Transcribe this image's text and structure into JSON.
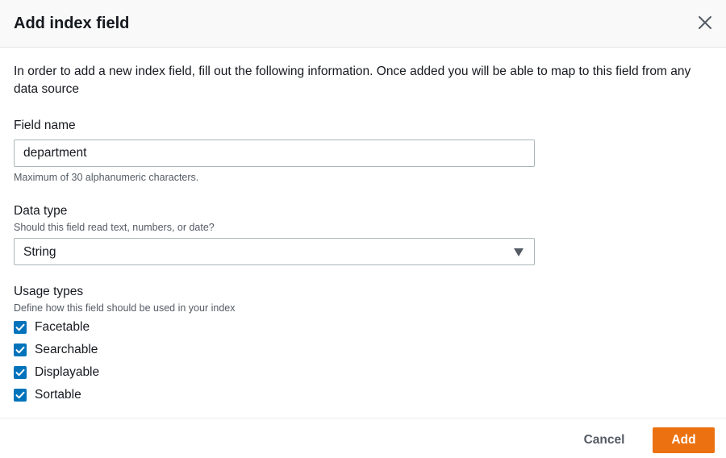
{
  "modal": {
    "title": "Add index field",
    "intro": "In order to add a new index field, fill out the following information. Once added you will be able to map to this field from any data source"
  },
  "field_name": {
    "label": "Field name",
    "value": "department",
    "hint": "Maximum of 30 alphanumeric characters."
  },
  "data_type": {
    "label": "Data type",
    "description": "Should this field read text, numbers, or date?",
    "selected": "String"
  },
  "usage_types": {
    "label": "Usage types",
    "description": "Define how this field should be used in your index",
    "options": [
      {
        "label": "Facetable",
        "checked": true
      },
      {
        "label": "Searchable",
        "checked": true
      },
      {
        "label": "Displayable",
        "checked": true
      },
      {
        "label": "Sortable",
        "checked": true
      }
    ]
  },
  "footer": {
    "cancel_label": "Cancel",
    "add_label": "Add"
  },
  "colors": {
    "primary_button": "#ec7211",
    "checkbox": "#0073bb",
    "header_bg": "#f9f9f9"
  },
  "icons": {
    "close": "close-icon",
    "caret": "caret-down-icon",
    "check": "checkmark-icon"
  }
}
